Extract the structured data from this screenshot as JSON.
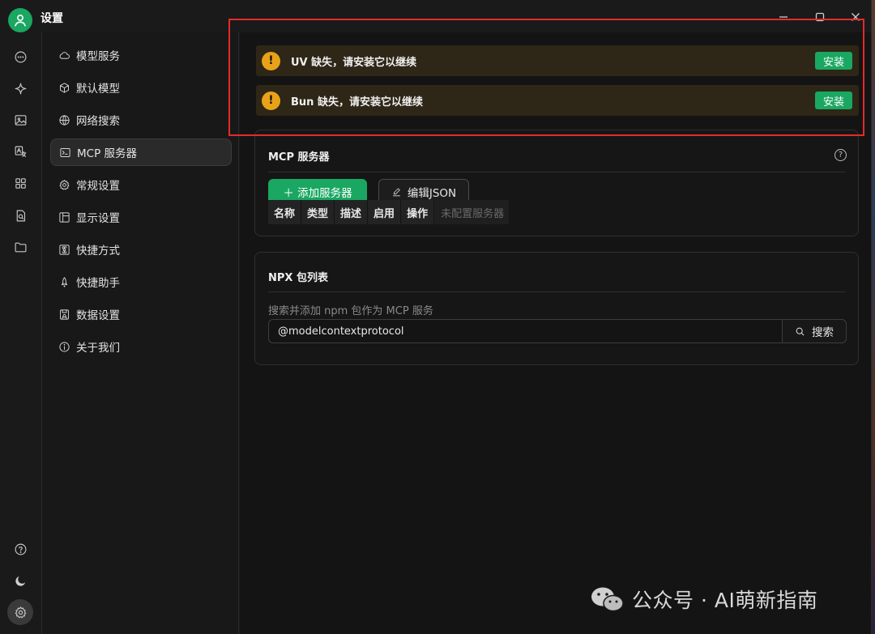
{
  "window": {
    "title": "设置"
  },
  "rail": {
    "icons": [
      "chat-icon",
      "sparkle-icon",
      "image-icon",
      "translate-icon",
      "apps-icon",
      "doc-search-icon",
      "folder-icon",
      "help-icon",
      "moon-icon",
      "settings-icon"
    ]
  },
  "nav": {
    "items": [
      {
        "label": "模型服务",
        "icon": "cloud-icon"
      },
      {
        "label": "默认模型",
        "icon": "cube-icon"
      },
      {
        "label": "网络搜索",
        "icon": "globe-icon"
      },
      {
        "label": "MCP 服务器",
        "icon": "terminal-icon"
      },
      {
        "label": "常规设置",
        "icon": "gear-icon"
      },
      {
        "label": "显示设置",
        "icon": "layout-icon"
      },
      {
        "label": "快捷方式",
        "icon": "command-icon"
      },
      {
        "label": "快捷助手",
        "icon": "rocket-icon"
      },
      {
        "label": "数据设置",
        "icon": "database-icon"
      },
      {
        "label": "关于我们",
        "icon": "info-icon"
      }
    ],
    "active": "MCP 服务器"
  },
  "alerts": [
    {
      "icon": "!",
      "text": "UV 缺失，请安装它以继续",
      "button": "安装"
    },
    {
      "icon": "!",
      "text": "Bun 缺失，请安装它以继续",
      "button": "安装"
    }
  ],
  "mcp": {
    "title": "MCP 服务器",
    "help": "?",
    "add_button": "＋ 添加服务器",
    "edit_button": "编辑JSON",
    "columns": [
      "名称",
      "类型",
      "描述",
      "启用",
      "操作"
    ],
    "empty_text": "未配置服务器"
  },
  "npx": {
    "title": "NPX 包列表",
    "field_label": "搜索并添加 npm 包作为 MCP 服务",
    "search_value": "@modelcontextprotocol",
    "search_button": "搜索"
  },
  "watermark": {
    "text": "公众号 · AI萌新指南"
  },
  "colors": {
    "accent": "#1aa761",
    "warning": "#e8a219",
    "highlight_border": "#e32b2b"
  }
}
